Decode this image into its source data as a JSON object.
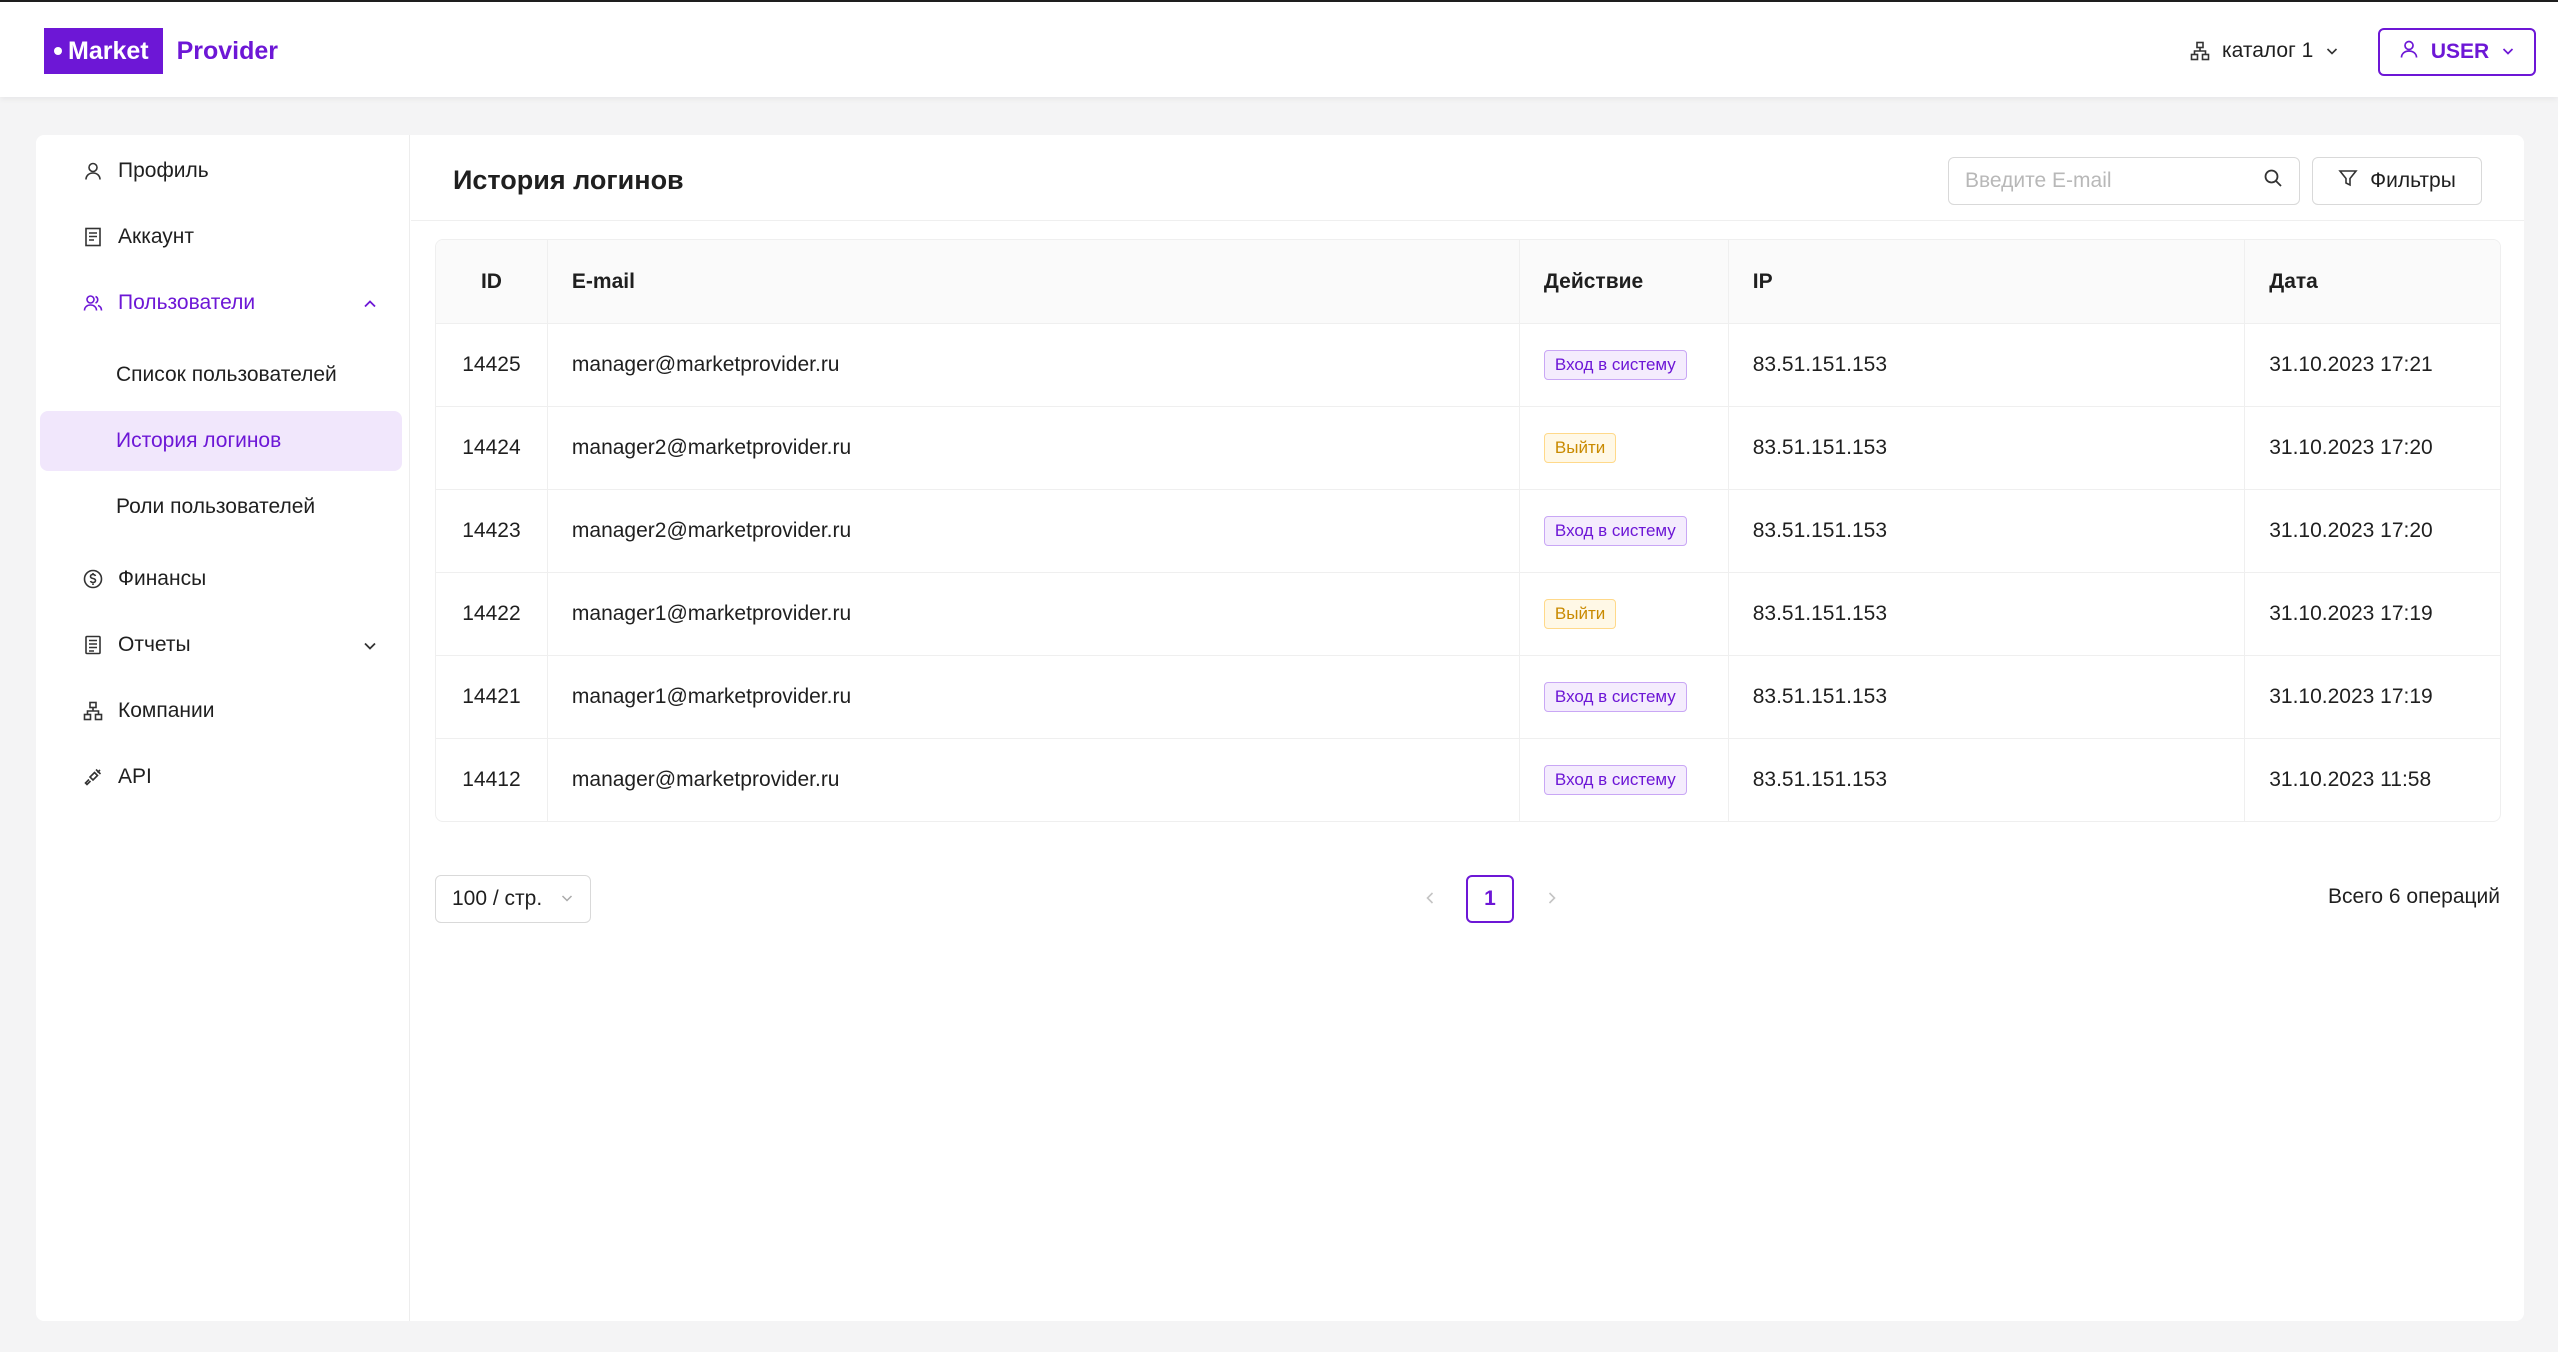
{
  "brand": {
    "box_text": "Market",
    "text": "Provider"
  },
  "header": {
    "catalog_label": "каталог 1",
    "user_label": "USER"
  },
  "sidebar": {
    "items": [
      {
        "label": "Профиль",
        "icon": "user-icon"
      },
      {
        "label": "Аккаунт",
        "icon": "receipt-icon"
      },
      {
        "label": "Пользователи",
        "icon": "users-icon"
      },
      {
        "label": "Финансы",
        "icon": "dollar-icon"
      },
      {
        "label": "Отчеты",
        "icon": "report-icon"
      },
      {
        "label": "Компании",
        "icon": "org-icon"
      },
      {
        "label": "API",
        "icon": "api-icon"
      }
    ],
    "sub_items": [
      {
        "label": "Список пользователей"
      },
      {
        "label": "История логинов"
      },
      {
        "label": "Роли пользователей"
      }
    ]
  },
  "main": {
    "title": "История логинов",
    "search_placeholder": "Введите E-mail",
    "filters_label": "Фильтры",
    "columns": [
      "ID",
      "E-mail",
      "Действие",
      "IP",
      "Дата"
    ],
    "rows": [
      {
        "id": "14425",
        "email": "manager@marketprovider.ru",
        "action": "Вход в систему",
        "type": "login",
        "ip": "83.51.151.153",
        "date": "31.10.2023 17:21"
      },
      {
        "id": "14424",
        "email": "manager2@marketprovider.ru",
        "action": "Выйти",
        "type": "logout",
        "ip": "83.51.151.153",
        "date": "31.10.2023 17:20"
      },
      {
        "id": "14423",
        "email": "manager2@marketprovider.ru",
        "action": "Вход в систему",
        "type": "login",
        "ip": "83.51.151.153",
        "date": "31.10.2023 17:20"
      },
      {
        "id": "14422",
        "email": "manager1@marketprovider.ru",
        "action": "Выйти",
        "type": "logout",
        "ip": "83.51.151.153",
        "date": "31.10.2023 17:19"
      },
      {
        "id": "14421",
        "email": "manager1@marketprovider.ru",
        "action": "Вход в систему",
        "type": "login",
        "ip": "83.51.151.153",
        "date": "31.10.2023 17:19"
      },
      {
        "id": "14412",
        "email": "manager@marketprovider.ru",
        "action": "Вход в систему",
        "type": "login",
        "ip": "83.51.151.153",
        "date": "31.10.2023 11:58"
      }
    ],
    "page_size": "100 / стр.",
    "current_page": "1",
    "total": "Всего 6 операций"
  },
  "colors": {
    "accent": "#6d17d6",
    "selected_bg": "#f1e7fc",
    "logout": "#c98a00"
  }
}
